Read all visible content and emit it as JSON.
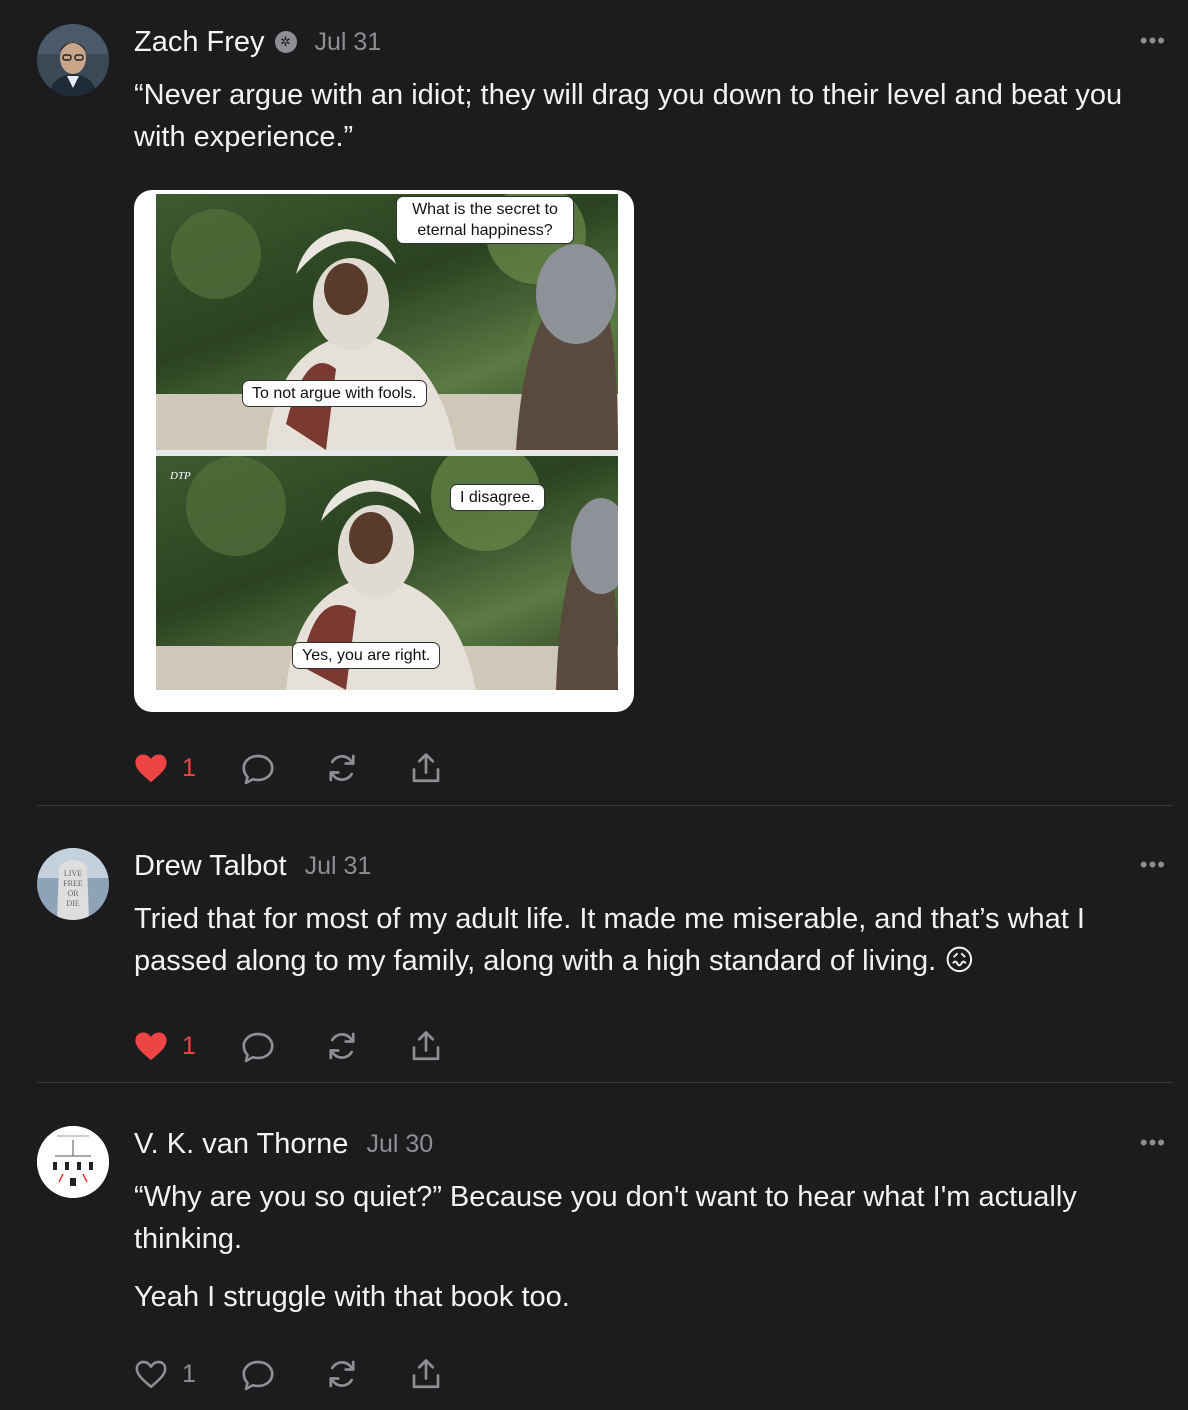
{
  "posts": [
    {
      "author": "Zach Frey",
      "date": "Jul 31",
      "paragraphs": [
        "“Never argue with an idiot; they will drag you down to their level and beat you with experience.”"
      ],
      "likes": "1",
      "liked": true,
      "meme": {
        "q1": "What is the secret to eternal happiness?",
        "a1": "To not argue with fools.",
        "q2": "I disagree.",
        "a2": "Yes, you are right.",
        "watermark": "DTP"
      }
    },
    {
      "author": "Drew Talbot",
      "date": "Jul 31",
      "paragraphs": [
        "Tried that for most of my adult life. It made me miserable, and that’s what I passed along to my family, along with a high standard of living. 😖"
      ],
      "likes": "1",
      "liked": true
    },
    {
      "author": "V. K. van Thorne",
      "date": "Jul 30",
      "paragraphs": [
        "“Why are you so quiet?” Because you don't want to hear what I'm actually thinking.",
        "Yeah I struggle with that book too."
      ],
      "likes": "1",
      "liked": false
    }
  ],
  "colors": {
    "background": "#1c1c1e",
    "like_active": "#ef4444",
    "muted": "#8e8e93",
    "divider": "#3a3a3c"
  },
  "icons": [
    "heart-icon",
    "comment-icon",
    "restack-icon",
    "share-icon",
    "more-icon"
  ],
  "avatar_text": {
    "drew": "LIVE FREE OR DIE"
  }
}
